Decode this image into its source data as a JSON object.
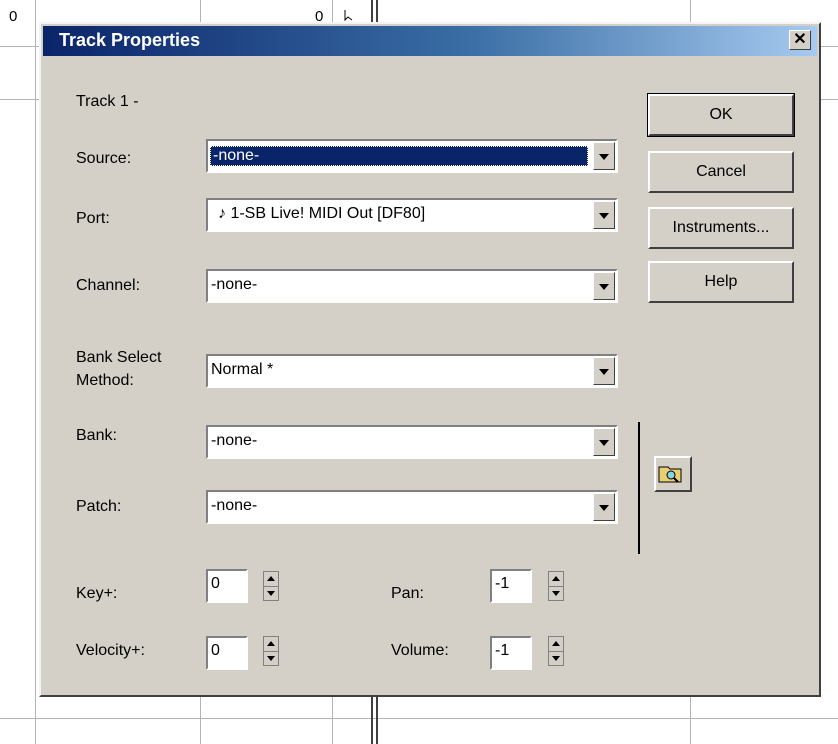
{
  "background": {
    "cell_left_value": "0",
    "cell_mid_value": "0"
  },
  "dialog": {
    "title": "Track Properties",
    "close_symbol": "✕",
    "track_label": "Track 1 -",
    "fields": {
      "source": {
        "label": "Source:",
        "value": "-none-"
      },
      "port": {
        "label": "Port:",
        "value": "♪ 1-SB Live! MIDI Out [DF80]"
      },
      "channel": {
        "label": "Channel:",
        "value": "-none-"
      },
      "bank_select_method": {
        "label_line1": "Bank Select",
        "label_line2": "Method:",
        "value": "Normal  *"
      },
      "bank": {
        "label": "Bank:",
        "value": "-none-"
      },
      "patch": {
        "label": "Patch:",
        "value": "-none-"
      }
    },
    "spinners": {
      "key": {
        "label": "Key+:",
        "value": "0"
      },
      "velocity": {
        "label": "Velocity+:",
        "value": "0"
      },
      "pan": {
        "label": "Pan:",
        "value": "-1"
      },
      "volume": {
        "label": "Volume:",
        "value": "-1"
      }
    },
    "buttons": {
      "ok": "OK",
      "cancel": "Cancel",
      "instruments": "Instruments...",
      "help": "Help"
    },
    "icons": {
      "close": "close-icon",
      "browse": "folder-search-icon",
      "dropdown": "chevron-down-icon"
    }
  }
}
